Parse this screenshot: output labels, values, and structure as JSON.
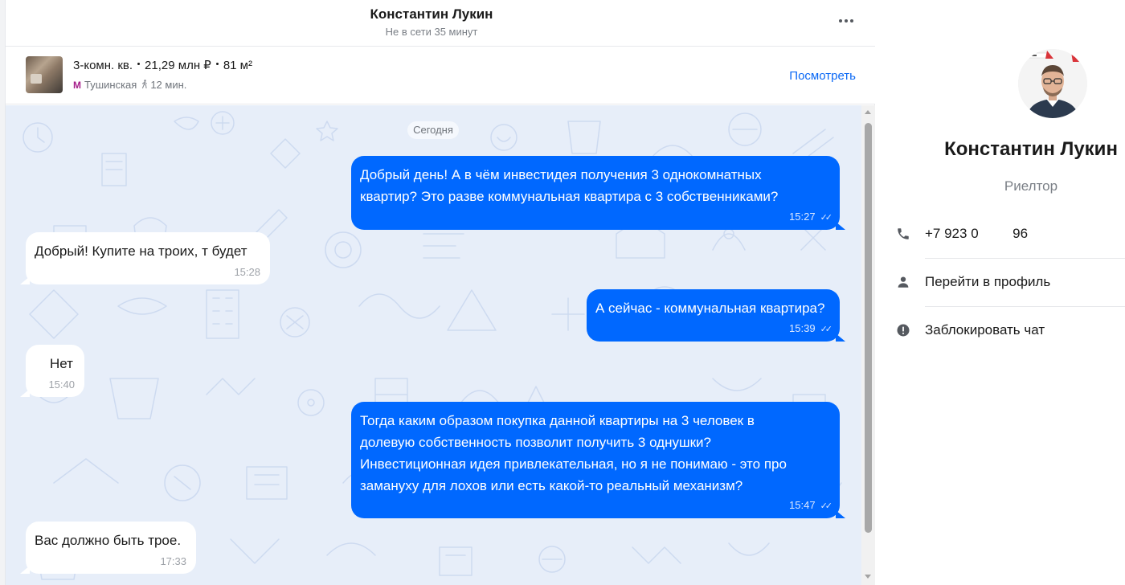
{
  "chat_header": {
    "name": "Константин Лукин",
    "status": "Не в сети 35 минут"
  },
  "listing": {
    "rooms": "3-комн. кв.",
    "price": "21,29 млн ₽",
    "area": "81 м²",
    "metro_icon": "М",
    "metro": "Тушинская",
    "walk": "12 мин.",
    "view_link": "Посмотреть"
  },
  "date_separator": "Сегодня",
  "messages": [
    {
      "direction": "out",
      "lines": [
        "Добрый день! А в чём инвестидея получения 3 однокомнатных",
        "квартир? Это разве коммунальная квартира с 3 собственниками?"
      ],
      "time": "15:27",
      "read": true
    },
    {
      "direction": "in",
      "lines": [
        "Добрый! Купите на троих, т будет"
      ],
      "time": "15:28"
    },
    {
      "direction": "out",
      "lines": [
        "А сейчас - коммунальная квартира?"
      ],
      "time": "15:39",
      "read": true
    },
    {
      "direction": "in",
      "lines": [
        "Нет"
      ],
      "time": "15:40"
    },
    {
      "direction": "out",
      "lines": [
        "Тогда каким образом покупка данной квартиры на 3 человек в",
        "долевую собственность позволит получить 3 однушки?",
        "Инвестиционная идея привлекательная, но я не понимаю - это про",
        "заманyху для лохов или есть какой-то реальный механизм?"
      ],
      "time": "15:47",
      "read": true
    },
    {
      "direction": "in",
      "lines": [
        "Вас должно быть трое."
      ],
      "time": "17:33"
    }
  ],
  "side_panel": {
    "name": "Константин Лукин",
    "role": "Риелтор",
    "phone": "+7 923 0         96",
    "profile_link": "Перейти в профиль",
    "block_chat": "Заблокировать чат"
  },
  "icons": {
    "more": "more-horizontal-icon",
    "metro": "metro-icon",
    "walk": "walking-person-icon",
    "read": "double-check-icon",
    "phone": "phone-icon",
    "profile": "person-icon",
    "block": "exclamation-circle-icon"
  },
  "colors": {
    "accent": "#0068ff",
    "link": "#0a68f5",
    "chat_background": "#e7eef9",
    "metro": "#a51d8a"
  }
}
